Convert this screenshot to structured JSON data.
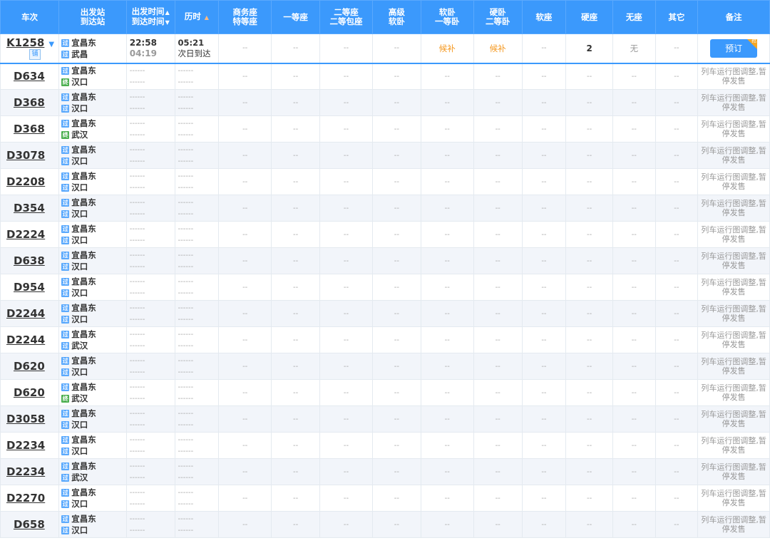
{
  "header": {
    "train": "车次",
    "from": "出发站",
    "to": "到达站",
    "dep_time": "出发时间",
    "arr_time": "到达时间",
    "duration": "历时",
    "business": "商务座",
    "special": "特等座",
    "first": "一等座",
    "second": "二等座",
    "second_box": "二等包座",
    "premium": "高级",
    "premium2": "软卧",
    "soft_sleeper": "软卧",
    "first_sleeper": "一等卧",
    "hard_sleeper": "硬卧",
    "second_sleeper": "二等卧",
    "soft_seat": "软座",
    "hard_seat": "硬座",
    "no_seat": "无座",
    "other": "其它",
    "remark": "备注"
  },
  "icons": {
    "pass": "过",
    "end": "终",
    "pu": "铺",
    "corner": "抢"
  },
  "first_row": {
    "train_no": "K1258",
    "from": "宜昌东",
    "to": "武昌",
    "dep": "22:58",
    "arr": "04:19",
    "dur": "05:21",
    "dur2": "次日到达",
    "seats": [
      "--",
      "--",
      "--",
      "--",
      "候补",
      "候补",
      "--",
      "2",
      "无",
      "--"
    ],
    "book": "预订"
  },
  "placeholders": {
    "seat": "--",
    "dash": "------"
  },
  "rows": [
    {
      "train_no": "D634",
      "from": "宜昌东",
      "to": "汉口",
      "to_icon": "end",
      "remark": "列车运行图调整,暂停发售"
    },
    {
      "train_no": "D368",
      "from": "宜昌东",
      "to": "汉口",
      "to_icon": "pass",
      "remark": "列车运行图调整,暂停发售"
    },
    {
      "train_no": "D368",
      "from": "宜昌东",
      "to": "武汉",
      "to_icon": "end",
      "remark": "列车运行图调整,暂停发售"
    },
    {
      "train_no": "D3078",
      "from": "宜昌东",
      "to": "汉口",
      "to_icon": "pass",
      "remark": "列车运行图调整,暂停发售"
    },
    {
      "train_no": "D2208",
      "from": "宜昌东",
      "to": "汉口",
      "to_icon": "pass",
      "remark": "列车运行图调整,暂停发售"
    },
    {
      "train_no": "D354",
      "from": "宜昌东",
      "to": "汉口",
      "to_icon": "pass",
      "remark": "列车运行图调整,暂停发售"
    },
    {
      "train_no": "D2224",
      "from": "宜昌东",
      "to": "汉口",
      "to_icon": "pass",
      "remark": "列车运行图调整,暂停发售"
    },
    {
      "train_no": "D638",
      "from": "宜昌东",
      "to": "汉口",
      "to_icon": "pass",
      "remark": "列车运行图调整,暂停发售"
    },
    {
      "train_no": "D954",
      "from": "宜昌东",
      "to": "汉口",
      "to_icon": "pass",
      "remark": "列车运行图调整,暂停发售"
    },
    {
      "train_no": "D2244",
      "from": "宜昌东",
      "to": "汉口",
      "to_icon": "pass",
      "remark": "列车运行图调整,暂停发售"
    },
    {
      "train_no": "D2244",
      "from": "宜昌东",
      "to": "武汉",
      "to_icon": "pass",
      "remark": "列车运行图调整,暂停发售"
    },
    {
      "train_no": "D620",
      "from": "宜昌东",
      "to": "汉口",
      "to_icon": "pass",
      "remark": "列车运行图调整,暂停发售"
    },
    {
      "train_no": "D620",
      "from": "宜昌东",
      "to": "武汉",
      "to_icon": "end",
      "remark": "列车运行图调整,暂停发售"
    },
    {
      "train_no": "D3058",
      "from": "宜昌东",
      "to": "汉口",
      "to_icon": "pass",
      "remark": "列车运行图调整,暂停发售"
    },
    {
      "train_no": "D2234",
      "from": "宜昌东",
      "to": "汉口",
      "to_icon": "pass",
      "remark": "列车运行图调整,暂停发售"
    },
    {
      "train_no": "D2234",
      "from": "宜昌东",
      "to": "武汉",
      "to_icon": "pass",
      "remark": "列车运行图调整,暂停发售"
    },
    {
      "train_no": "D2270",
      "from": "宜昌东",
      "to": "汉口",
      "to_icon": "pass",
      "remark": "列车运行图调整,暂停发售"
    },
    {
      "train_no": "D658",
      "from": "宜昌东",
      "to": "汉口",
      "to_icon": "pass",
      "remark": "列车运行图调整,暂停发售"
    }
  ],
  "colors": {
    "header_bg": "#3b99fc",
    "accent": "#3b99fc",
    "waitlist": "#f59a23",
    "row_alt": "#f2f5fa"
  }
}
